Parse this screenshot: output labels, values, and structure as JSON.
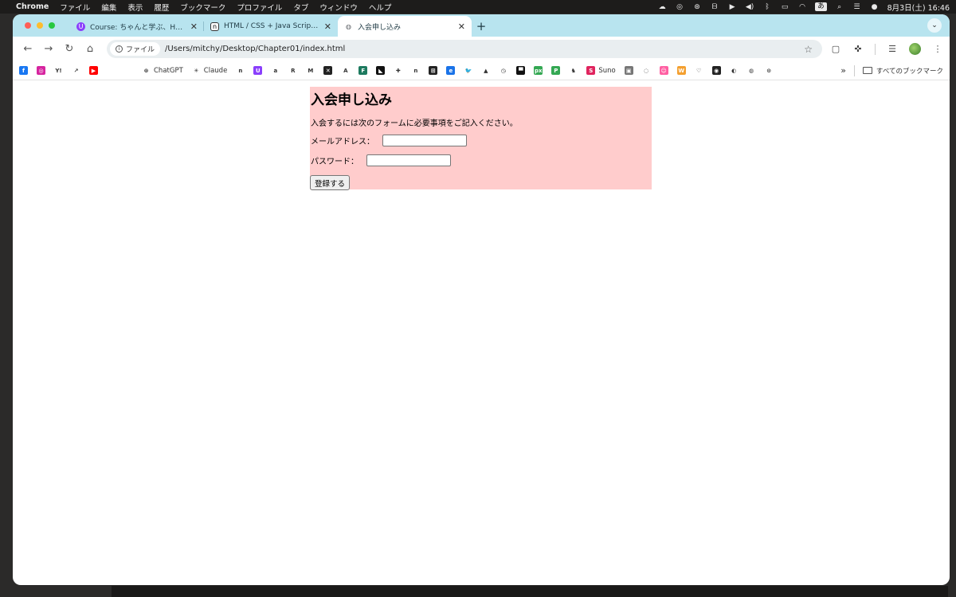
{
  "menubar": {
    "app": "Chrome",
    "items": [
      "ファイル",
      "編集",
      "表示",
      "履歴",
      "ブックマーク",
      "プロファイル",
      "タブ",
      "ウィンドウ",
      "ヘルプ"
    ],
    "ime": "あ",
    "datetime": "8月3日(土)  16:46"
  },
  "tabs": [
    {
      "title": "Course: ちゃんと学ぶ、HTML/…",
      "favicon_color": "#8a3ffc",
      "favicon_glyph": "U"
    },
    {
      "title": "HTML / CSS + Java Script No…",
      "favicon_color": "#ffffff",
      "favicon_glyph": "n"
    },
    {
      "title": "入会申し込み",
      "favicon_color": "#5f6368",
      "favicon_glyph": "◍"
    }
  ],
  "toolbar": {
    "chip_label": "ファイル",
    "url": "/Users/mitchy/Desktop/Chapter01/index.html"
  },
  "bookmarks": {
    "items": [
      {
        "label": "",
        "color": "#1877f2",
        "glyph": "f"
      },
      {
        "label": "",
        "color": "#d6249f",
        "glyph": "◎"
      },
      {
        "label": "",
        "color": "#ffffff",
        "glyph": "Y!"
      },
      {
        "label": "",
        "color": "#ffffff",
        "glyph": "↗"
      },
      {
        "label": "",
        "color": "#ff0000",
        "glyph": "▶"
      },
      {
        "label": "",
        "color": "#ffffff",
        "glyph": ""
      },
      {
        "label": "",
        "color": "#ffffff",
        "glyph": ""
      },
      {
        "label": "ChatGPT",
        "color": "#ffffff",
        "glyph": "⊛"
      },
      {
        "label": "Claude",
        "color": "#ffffff",
        "glyph": "✳"
      },
      {
        "label": "",
        "color": "#ffffff",
        "glyph": "n"
      },
      {
        "label": "",
        "color": "#8a3ffc",
        "glyph": "U"
      },
      {
        "label": "",
        "color": "#ffffff",
        "glyph": "a"
      },
      {
        "label": "",
        "color": "#ffffff",
        "glyph": "R"
      },
      {
        "label": "",
        "color": "#ffffff",
        "glyph": "M"
      },
      {
        "label": "",
        "color": "#222222",
        "glyph": "✕"
      },
      {
        "label": "",
        "color": "#ffffff",
        "glyph": "A"
      },
      {
        "label": "",
        "color": "#1d7a5f",
        "glyph": "F"
      },
      {
        "label": "",
        "color": "#111111",
        "glyph": "◣"
      },
      {
        "label": "",
        "color": "#ffffff",
        "glyph": "✚"
      },
      {
        "label": "",
        "color": "#ffffff",
        "glyph": "n"
      },
      {
        "label": "",
        "color": "#222222",
        "glyph": "⊞"
      },
      {
        "label": "",
        "color": "#1a73e8",
        "glyph": "e"
      },
      {
        "label": "",
        "color": "#ffffff",
        "glyph": "🐦"
      },
      {
        "label": "",
        "color": "#ffffff",
        "glyph": "▲"
      },
      {
        "label": "",
        "color": "#ffffff",
        "glyph": "◷"
      },
      {
        "label": "",
        "color": "#111111",
        "glyph": "▀"
      },
      {
        "label": "",
        "color": "#34a853",
        "glyph": "px"
      },
      {
        "label": "",
        "color": "#34a853",
        "glyph": "P"
      },
      {
        "label": "",
        "color": "#ffffff",
        "glyph": "♞"
      },
      {
        "label": "Suno",
        "color": "#e0245e",
        "glyph": "S"
      },
      {
        "label": "",
        "color": "#777777",
        "glyph": "▣"
      },
      {
        "label": "",
        "color": "#ffffff",
        "glyph": "◌"
      },
      {
        "label": "",
        "color": "#ff5fa2",
        "glyph": "☺"
      },
      {
        "label": "",
        "color": "#f4a030",
        "glyph": "W"
      },
      {
        "label": "",
        "color": "#ffffff",
        "glyph": "♡"
      },
      {
        "label": "",
        "color": "#222222",
        "glyph": "◉"
      },
      {
        "label": "",
        "color": "#ffffff",
        "glyph": "◐"
      },
      {
        "label": "",
        "color": "#ffffff",
        "glyph": "◍"
      },
      {
        "label": "",
        "color": "#ffffff",
        "glyph": "⊙"
      }
    ],
    "folder_label": "すべてのブックマーク"
  },
  "page": {
    "heading": "入会申し込み",
    "description": "入会するには次のフォームに必要事項をご記入ください。",
    "email_label": "メールアドレス：",
    "password_label": "パスワード：",
    "submit_label": "登録する"
  },
  "colors": {
    "form_background": "#ffcccc",
    "tabstrip_background": "#b8e4ef"
  }
}
